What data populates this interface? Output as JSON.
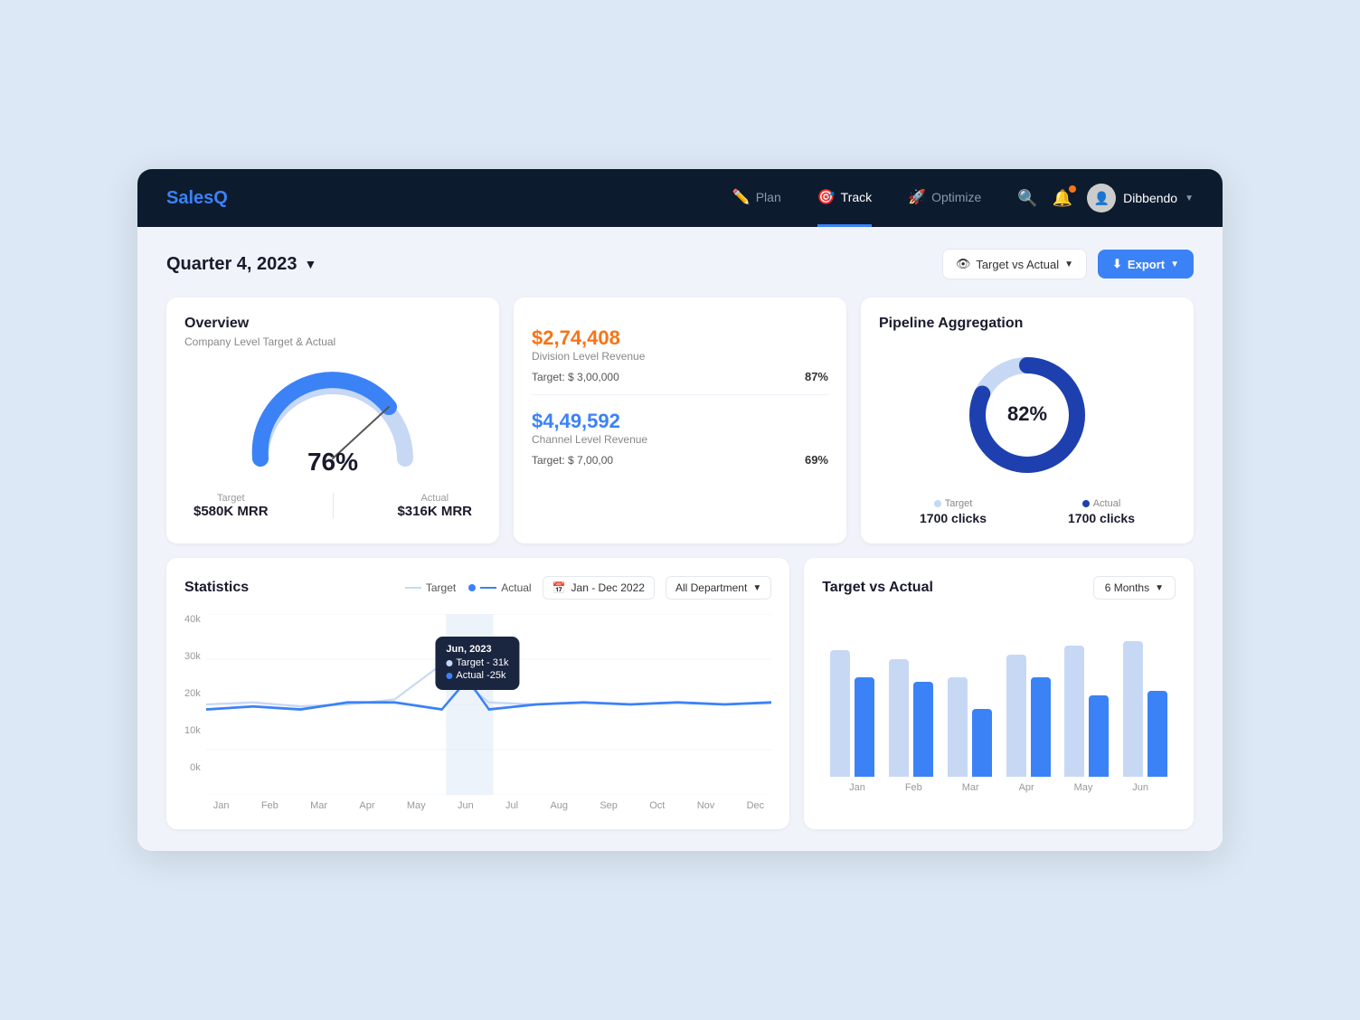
{
  "app": {
    "name": "SalesQ"
  },
  "nav": {
    "items": [
      {
        "id": "plan",
        "label": "Plan",
        "icon": "✏️",
        "active": false
      },
      {
        "id": "track",
        "label": "Track",
        "icon": "🎯",
        "active": true
      },
      {
        "id": "optimize",
        "label": "Optimize",
        "icon": "🚀",
        "active": false
      }
    ],
    "user": {
      "name": "Dibbendo"
    }
  },
  "page": {
    "quarter": "Quarter 4, 2023",
    "target_actual_label": "Target vs Actual",
    "export_label": "Export"
  },
  "overview": {
    "title": "Overview",
    "subtitle": "Company Level Target & Actual",
    "percent": "76%",
    "target_label": "Target",
    "target_value": "$580K MRR",
    "actual_label": "Actual",
    "actual_value": "$316K MRR"
  },
  "division_revenue": {
    "amount": "$2,74,408",
    "label": "Division Level Revenue",
    "target": "Target: $ 3,00,000",
    "pct": "87%"
  },
  "channel_revenue": {
    "amount": "$4,49,592",
    "label": "Channel Level Revenue",
    "target": "Target: $ 7,00,00",
    "pct": "69%"
  },
  "pipeline": {
    "title": "Pipeline Aggregation",
    "percent": "82%",
    "target_label": "Target",
    "target_value": "1700 clicks",
    "actual_label": "Actual",
    "actual_value": "1700 clicks"
  },
  "statistics": {
    "title": "Statistics",
    "target_legend": "Target",
    "actual_legend": "Actual",
    "date_range": "Jan - Dec 2022",
    "department": "All Department",
    "tooltip": {
      "date": "Jun, 2023",
      "target_label": "Target - 31k",
      "actual_label": "Actual -25k"
    },
    "x_labels": [
      "Jan",
      "Feb",
      "Mar",
      "Apr",
      "May",
      "Jun",
      "Jul",
      "Aug",
      "Sep",
      "Oct",
      "Nov",
      "Dec"
    ],
    "y_labels": [
      "40k",
      "30k",
      "20k",
      "10k",
      "0k"
    ]
  },
  "target_vs_actual": {
    "title": "Target vs Actual",
    "months_label": "6 Months",
    "x_labels": [
      "Jan",
      "Feb",
      "Mar",
      "Apr",
      "May",
      "Jun"
    ],
    "bars": [
      {
        "target_h": 140,
        "actual_h": 110
      },
      {
        "target_h": 130,
        "actual_h": 105
      },
      {
        "target_h": 110,
        "actual_h": 75
      },
      {
        "target_h": 135,
        "actual_h": 110
      },
      {
        "target_h": 145,
        "actual_h": 90
      },
      {
        "target_h": 150,
        "actual_h": 95
      }
    ]
  }
}
